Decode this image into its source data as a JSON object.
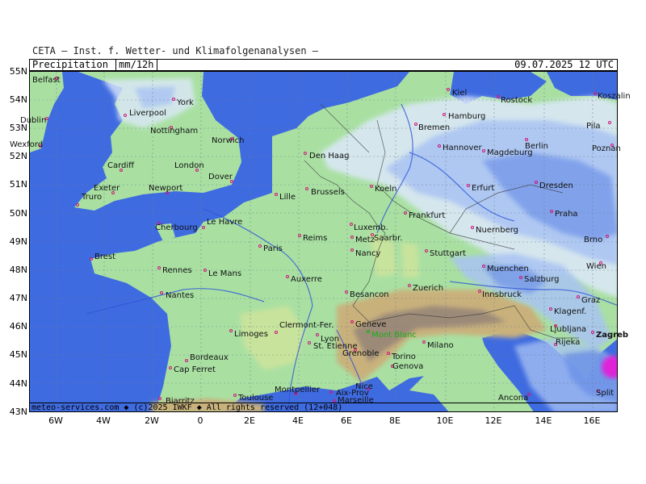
{
  "header": {
    "source": "CETA — Inst. f. Wetter- und Klimafolgenanalysen —"
  },
  "title_bar": {
    "variable": "Precipitation",
    "unit": "mm/12h",
    "datetime": "09.07.2025  12 UTC"
  },
  "credit": "meteo-services.com ◆ (c)2025 IWKF ◆ All rights reserved (12+048)",
  "axes": {
    "lat_labels": [
      "55N",
      "54N",
      "53N",
      "52N",
      "51N",
      "50N",
      "49N",
      "48N",
      "47N",
      "46N",
      "45N",
      "44N",
      "43N"
    ],
    "lon_labels": [
      "6W",
      "4W",
      "2W",
      "0",
      "2E",
      "4E",
      "6E",
      "8E",
      "10E",
      "12E",
      "14E",
      "16E"
    ]
  },
  "colors": {
    "sea": "#3f6be0",
    "land_low": "#a9e0a2",
    "land_mid": "#c8e39c",
    "mountain": "#c9b17c",
    "mountain_high": "#9c8a78",
    "precip_light": "#dde8fb",
    "precip_mid": "#a9c3f3",
    "precip_heavy": "#6e93e8",
    "precip_extreme": "#e020d8",
    "city_marker": "#d0157a",
    "mont_blanc": "#18b018"
  },
  "cities": [
    {
      "name": "Belfast"
    },
    {
      "name": "York"
    },
    {
      "name": "Liverpool"
    },
    {
      "name": "Dublin"
    },
    {
      "name": "Nottingham"
    },
    {
      "name": "Norwich"
    },
    {
      "name": "Wexford"
    },
    {
      "name": "Cardiff"
    },
    {
      "name": "London"
    },
    {
      "name": "Dover"
    },
    {
      "name": "Exeter"
    },
    {
      "name": "Newport"
    },
    {
      "name": "Truro"
    },
    {
      "name": "Kiel"
    },
    {
      "name": "Rostock"
    },
    {
      "name": "Koszalin"
    },
    {
      "name": "Hamburg"
    },
    {
      "name": "Bremen"
    },
    {
      "name": "Pila"
    },
    {
      "name": "Den Haag"
    },
    {
      "name": "Hannover"
    },
    {
      "name": "Magdeburg"
    },
    {
      "name": "Berlin"
    },
    {
      "name": "Poznan"
    },
    {
      "name": "Lille"
    },
    {
      "name": "Brussels"
    },
    {
      "name": "Koeln"
    },
    {
      "name": "Erfurt"
    },
    {
      "name": "Dresden"
    },
    {
      "name": "Le Havre"
    },
    {
      "name": "Luxemb."
    },
    {
      "name": "Frankfurt"
    },
    {
      "name": "Praha"
    },
    {
      "name": "Cherbourg"
    },
    {
      "name": "Reims"
    },
    {
      "name": "Metz"
    },
    {
      "name": "Saarbr."
    },
    {
      "name": "Nuernberg"
    },
    {
      "name": "Brno"
    },
    {
      "name": "Paris"
    },
    {
      "name": "Brest"
    },
    {
      "name": "Nancy"
    },
    {
      "name": "Stuttgart"
    },
    {
      "name": "Rennes"
    },
    {
      "name": "Le Mans"
    },
    {
      "name": "Muenchen"
    },
    {
      "name": "Wien"
    },
    {
      "name": "Auxerre"
    },
    {
      "name": "Salzburg"
    },
    {
      "name": "Zuerich"
    },
    {
      "name": "Nantes"
    },
    {
      "name": "Besancon"
    },
    {
      "name": "Innsbruck"
    },
    {
      "name": "Graz"
    },
    {
      "name": "Klagenf."
    },
    {
      "name": "Limoges"
    },
    {
      "name": "Clermont-Fer."
    },
    {
      "name": "Geneve"
    },
    {
      "name": "Mont Blanc"
    },
    {
      "name": "Ljubljana"
    },
    {
      "name": "Zagreb"
    },
    {
      "name": "Lyon"
    },
    {
      "name": "St. Etienne"
    },
    {
      "name": "Milano"
    },
    {
      "name": "Rijeka"
    },
    {
      "name": "Bordeaux"
    },
    {
      "name": "Grenoble"
    },
    {
      "name": "Torino"
    },
    {
      "name": "Genova"
    },
    {
      "name": "Cap Ferret"
    },
    {
      "name": "Montpellier"
    },
    {
      "name": "Nice"
    },
    {
      "name": "Toulouse"
    },
    {
      "name": "Aix-Prov"
    },
    {
      "name": "Ancona"
    },
    {
      "name": "Split"
    },
    {
      "name": "Biarritz"
    },
    {
      "name": "Marseille"
    }
  ]
}
